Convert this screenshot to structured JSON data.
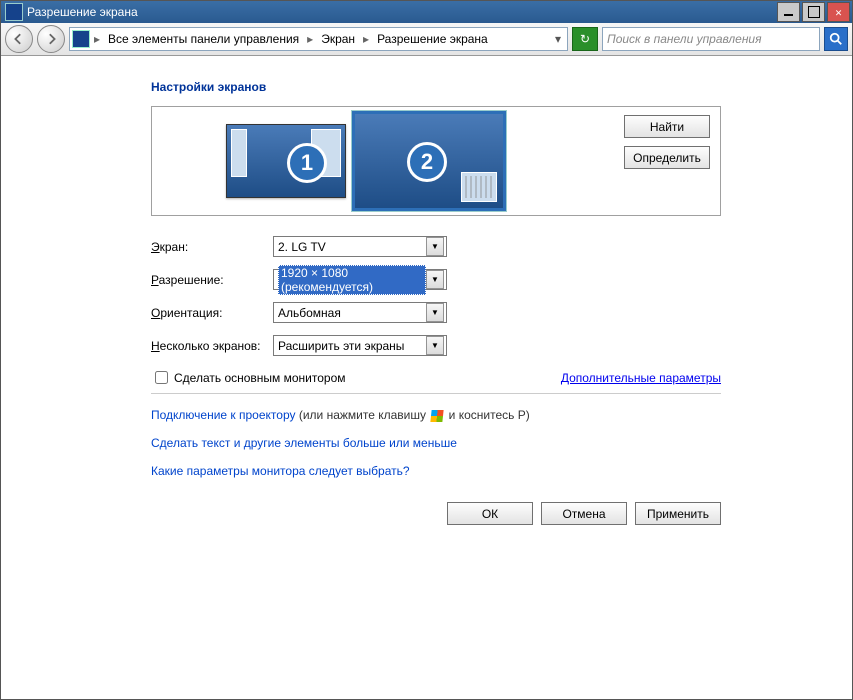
{
  "window": {
    "title": "Разрешение экрана"
  },
  "titlebar_buttons": {
    "min": "_",
    "max": "▢",
    "close": "✕"
  },
  "nav": {
    "breadcrumbs": {
      "root": "Все элементы панели управления",
      "level2": "Экран",
      "level3": "Разрешение экрана"
    },
    "search_placeholder": "Поиск в панели управления"
  },
  "heading": "Настройки экранов",
  "preview": {
    "monitor1": "1",
    "monitor2": "2",
    "find_button": "Найти",
    "identify_button": "Определить"
  },
  "form": {
    "screen": {
      "label_pre": "Э",
      "label_post": "кран:",
      "value": "2. LG TV"
    },
    "resolution": {
      "label_pre": "Р",
      "label_post": "азрешение:",
      "value": "1920 × 1080 (рекомендуется)"
    },
    "orientation": {
      "label_pre": "О",
      "label_post": "риентация:",
      "value": "Альбомная"
    },
    "multiscreen": {
      "label_pre": "Н",
      "label_post": "есколько экранов:",
      "value": "Расширить эти экраны"
    },
    "make_primary": "Сделать основным монитором",
    "advanced_link": "Дополнительные параметры"
  },
  "links": {
    "projector_link": "Подключение к проектору",
    "projector_hint_pre": " (или нажмите клавишу ",
    "projector_hint_post": " и коснитесь P)",
    "text_size": "Сделать текст и другие элементы больше или меньше",
    "which_monitor": "Какие параметры монитора следует выбрать?"
  },
  "buttons": {
    "ok": "ОК",
    "cancel": "Отмена",
    "apply": "Применить"
  }
}
